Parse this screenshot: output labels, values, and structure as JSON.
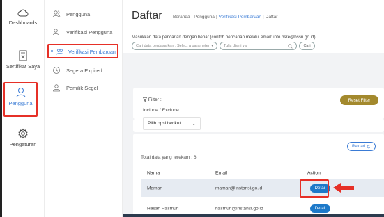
{
  "rail": {
    "items": [
      {
        "label": "Dashboards",
        "icon": "cloud-icon"
      },
      {
        "label": "Sertifikat Saya",
        "icon": "certificate-icon"
      },
      {
        "label": "Pengguna",
        "icon": "user-icon"
      },
      {
        "label": "Pengaturan",
        "icon": "gear-icon"
      }
    ]
  },
  "submenu": {
    "items": [
      {
        "label": "Pengguna",
        "icon": "users-icon"
      },
      {
        "label": "Verifikasi Pengguna",
        "icon": "user-check-icon"
      },
      {
        "label": "Verifikasi Pembaruan",
        "icon": "users-refresh-icon"
      },
      {
        "label": "Segera Expired",
        "icon": "clock-icon"
      },
      {
        "label": "Pemilik Segel",
        "icon": "user-seal-icon"
      }
    ]
  },
  "header": {
    "title": "Daftar",
    "breadcrumb": [
      "Beranda",
      "Pengguna",
      "Verifikasi Pembaruan",
      "Daftar"
    ],
    "hint": "Masukkan data pencarian dengan benar (contoh pencarian melalui email: info.bsre@bssn.go.id)",
    "param_placeholder": "Cari data berdasarkan : Select a parameter",
    "query_placeholder": "Tulis disini ya",
    "search_label": "Cari"
  },
  "filter": {
    "title": "Filter :",
    "sub_label": "Include / Exclude",
    "select_value": "Pilih opsi berikut",
    "reset_label": "Reset Filter"
  },
  "table": {
    "reload_label": "Reload",
    "total_text": "Total data yang terekam : 6",
    "columns": [
      "Nama",
      "Email",
      "Action"
    ],
    "rows": [
      {
        "nama": "Maman",
        "email": "maman@instansi.go.id",
        "action": "Detail"
      },
      {
        "nama": "Hasan Hasmuri",
        "email": "hasmuri@instansi.go.id",
        "action": "Detail"
      }
    ]
  },
  "colors": {
    "accent": "#3a7bd5",
    "highlight": "#e63027",
    "reset_button": "#a3892d",
    "detail_button": "#1d79c9"
  }
}
